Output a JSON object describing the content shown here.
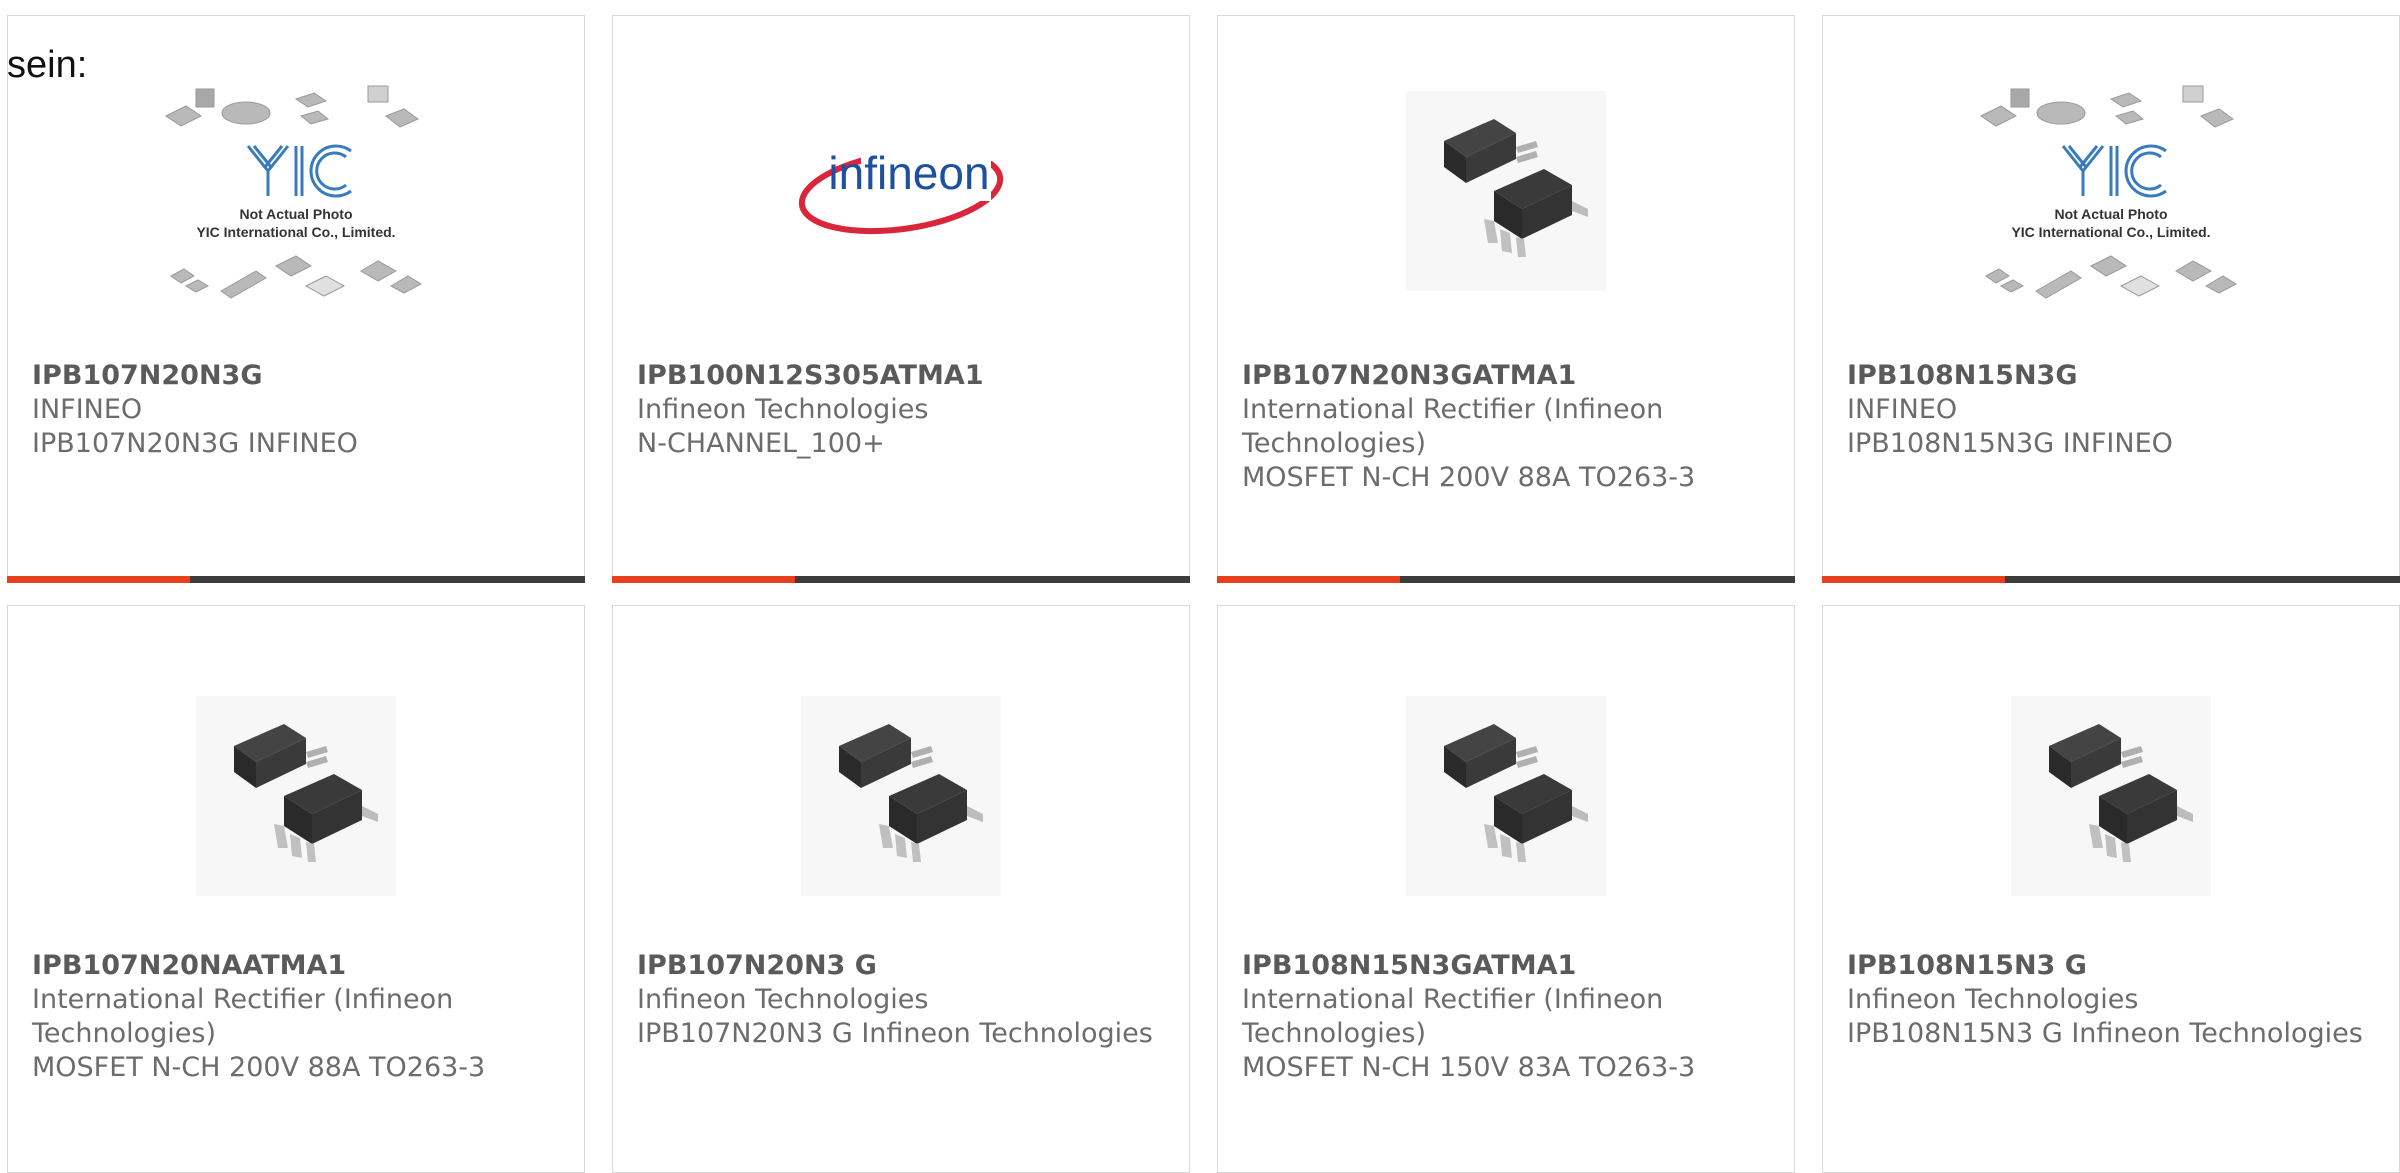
{
  "intro_text": "sein:",
  "colors": {
    "accent": "#e8401c",
    "bar": "#3c3c3c",
    "card_border": "#d9d9d9",
    "text": "#6c6c6c"
  },
  "products": [
    {
      "part_number": "IPB107N20N3G",
      "manufacturer": "INFINEO",
      "description": "IPB107N20N3G INFINEO",
      "image": "yic-placeholder",
      "placeholder_caption_1": "Not Actual Photo",
      "placeholder_caption_2": "YIC International Co., Limited."
    },
    {
      "part_number": "IPB100N12S305ATMA1",
      "manufacturer": "Infineon Technologies",
      "description": "N-CHANNEL_100+",
      "image": "infineon-logo",
      "logo_text": "infineon"
    },
    {
      "part_number": "IPB107N20N3GATMA1",
      "manufacturer": "International Rectifier (Infineon Technologies)",
      "description": "MOSFET N-CH 200V 88A TO263-3",
      "image": "to263-package"
    },
    {
      "part_number": "IPB108N15N3G",
      "manufacturer": "INFINEO",
      "description": "IPB108N15N3G INFINEO",
      "image": "yic-placeholder",
      "placeholder_caption_1": "Not Actual Photo",
      "placeholder_caption_2": "YIC International Co., Limited."
    },
    {
      "part_number": "IPB107N20NAATMA1",
      "manufacturer": "International Rectifier (Infineon Technologies)",
      "description": "MOSFET N-CH 200V 88A TO263-3",
      "image": "to263-package"
    },
    {
      "part_number": "IPB107N20N3 G",
      "manufacturer": "Infineon Technologies",
      "description": "IPB107N20N3 G Infineon Technologies",
      "image": "to263-package"
    },
    {
      "part_number": "IPB108N15N3GATMA1",
      "manufacturer": "International Rectifier (Infineon Technologies)",
      "description": "MOSFET N-CH 150V 83A TO263-3",
      "image": "to263-package"
    },
    {
      "part_number": "IPB108N15N3 G",
      "manufacturer": "Infineon Technologies",
      "description": "IPB108N15N3 G Infineon Technologies",
      "image": "to263-package"
    }
  ]
}
